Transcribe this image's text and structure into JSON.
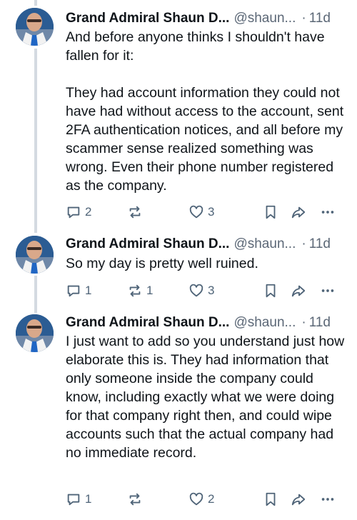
{
  "posts": [
    {
      "author": "Grand Admiral Shaun D...",
      "handle": "@shaun...",
      "separator": "·",
      "time": "11d",
      "text": "And before anyone thinks I shouldn't have fallen for it:\n\nThey had account information they could not have had without access to the account, sent 2FA authentication notices, and all before my scammer sense realized something was wrong. Even their phone number registered as the company.",
      "replies": "2",
      "reposts": "",
      "likes": "3"
    },
    {
      "author": "Grand Admiral Shaun D...",
      "handle": "@shaun...",
      "separator": "·",
      "time": "11d",
      "text": "So my day is pretty well ruined.",
      "replies": "1",
      "reposts": "1",
      "likes": "3"
    },
    {
      "author": "Grand Admiral Shaun D...",
      "handle": "@shaun...",
      "separator": "·",
      "time": "11d",
      "text": "I just want to add so you understand just how elaborate this is. They had information that only someone inside the company could know, including exactly what we were doing for that company right then, and could wipe accounts such that the actual company had no immediate record.",
      "replies": "1",
      "reposts": "",
      "likes": "2"
    }
  ],
  "icons": {
    "reply": "reply-icon",
    "repost": "repost-icon",
    "like": "heart-icon",
    "bookmark": "bookmark-icon",
    "share": "share-icon",
    "more": "more-icon"
  },
  "colors": {
    "text": "#0f1419",
    "muted": "#5b6776",
    "icon": "#4f6478",
    "thread_line": "#d4dae1"
  }
}
